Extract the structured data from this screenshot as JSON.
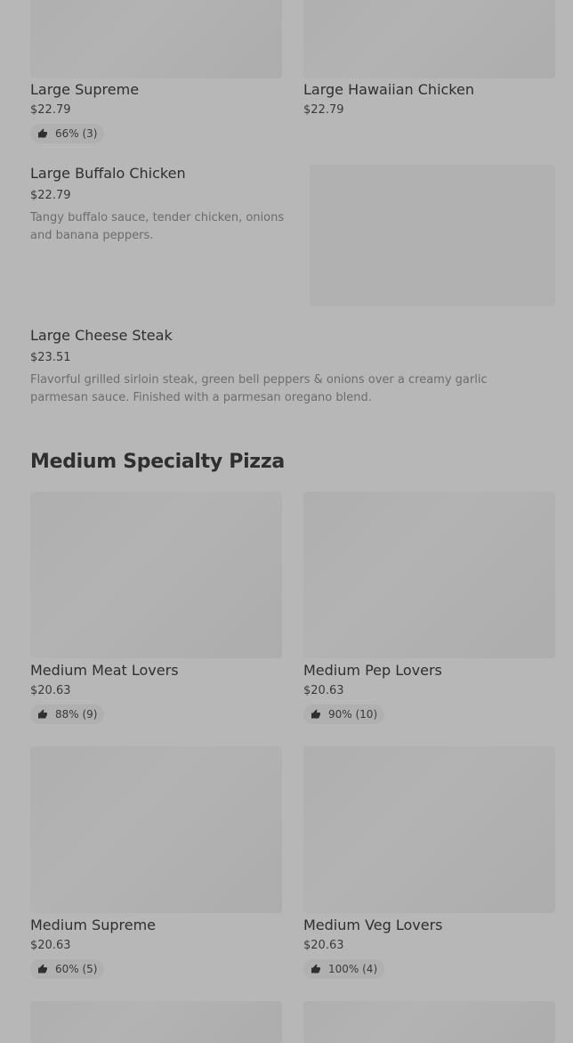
{
  "large": {
    "supreme": {
      "name": "Large Supreme",
      "price": "$22.79",
      "rating": "66% (3)"
    },
    "hawaiian_chicken": {
      "name": "Large Hawaiian Chicken",
      "price": "$22.79"
    },
    "buffalo_chicken": {
      "name": "Large Buffalo Chicken",
      "price": "$22.79",
      "description": "Tangy buffalo sauce, tender chicken, onions and banana peppers."
    },
    "cheese_steak": {
      "name": "Large Cheese Steak",
      "price": "$23.51",
      "description": "Flavorful grilled sirloin steak, green bell peppers & onions over a creamy garlic parmesan sauce. Finished with a parmesan oregano blend."
    }
  },
  "medium_section": {
    "title": "Medium Specialty Pizza",
    "meat_lovers": {
      "name": "Medium Meat Lovers",
      "price": "$20.63",
      "rating": "88% (9)"
    },
    "pep_lovers": {
      "name": "Medium Pep Lovers",
      "price": "$20.63",
      "rating": "90% (10)"
    },
    "supreme": {
      "name": "Medium Supreme",
      "price": "$20.63",
      "rating": "60% (5)"
    },
    "veg_lovers": {
      "name": "Medium Veg Lovers",
      "price": "$20.63",
      "rating": "100% (4)"
    }
  },
  "icons": {
    "rating": "thumbs-up-icon"
  }
}
